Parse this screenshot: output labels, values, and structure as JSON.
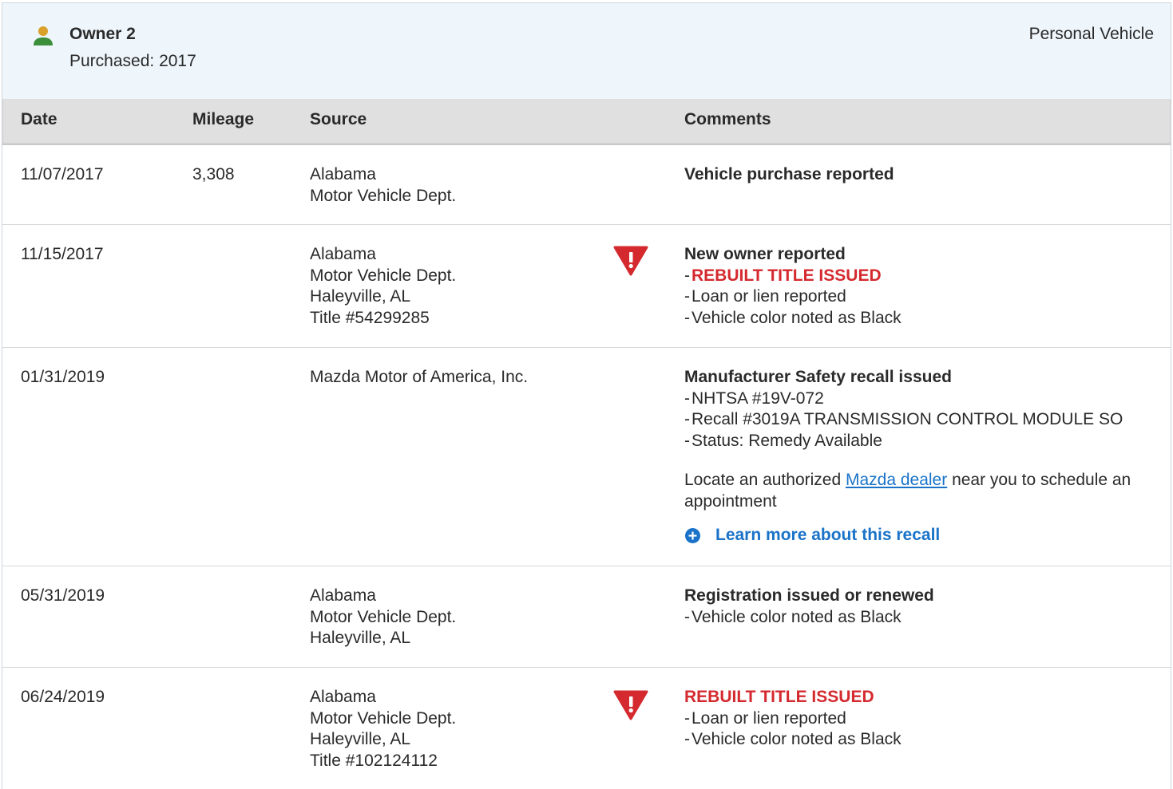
{
  "owner": {
    "name": "Owner 2",
    "purchased": "Purchased: 2017",
    "type": "Personal Vehicle",
    "icon": "person-icon",
    "icon_color": "#3b8f3b"
  },
  "columns": [
    "Date",
    "Mileage",
    "Source",
    "Comments"
  ],
  "colors": {
    "alert": "#d42a2f",
    "link": "#1a73c8",
    "header_bg": "#eef5fb",
    "table_head_bg": "#e0e0e0"
  },
  "rows": [
    {
      "date": "11/07/2017",
      "mileage": "3,308",
      "source": [
        "Alabama",
        "Motor Vehicle Dept."
      ],
      "title": "Vehicle purchase reported",
      "items": []
    },
    {
      "date": "11/15/2017",
      "mileage": "",
      "source": [
        "Alabama",
        "Motor Vehicle Dept.",
        "Haleyville, AL",
        "Title #54299285"
      ],
      "alert": true,
      "title": "New owner reported",
      "red_item": "REBUILT TITLE ISSUED",
      "items": [
        "Loan or lien reported",
        "Vehicle color noted as Black"
      ]
    },
    {
      "date": "01/31/2019",
      "mileage": "",
      "source": [
        "Mazda Motor of America, Inc."
      ],
      "title": "Manufacturer Safety recall issued",
      "items": [
        "NHTSA #19V-072",
        "Recall #3019A TRANSMISSION CONTROL MODULE SO",
        "Status: Remedy Available"
      ],
      "para_before": "Locate an authorized ",
      "para_link": "Mazda dealer",
      "para_after": " near you to schedule an appointment",
      "learn_more": "Learn more about this recall"
    },
    {
      "date": "05/31/2019",
      "mileage": "",
      "source": [
        "Alabama",
        "Motor Vehicle Dept.",
        "Haleyville, AL"
      ],
      "title": "Registration issued or renewed",
      "items": [
        "Vehicle color noted as Black"
      ]
    },
    {
      "date": "06/24/2019",
      "mileage": "",
      "source": [
        "Alabama",
        "Motor Vehicle Dept.",
        "Haleyville, AL",
        "Title #102124112"
      ],
      "alert": true,
      "red_title": "REBUILT TITLE ISSUED",
      "items": [
        "Loan or lien reported",
        "Vehicle color noted as Black"
      ]
    }
  ]
}
